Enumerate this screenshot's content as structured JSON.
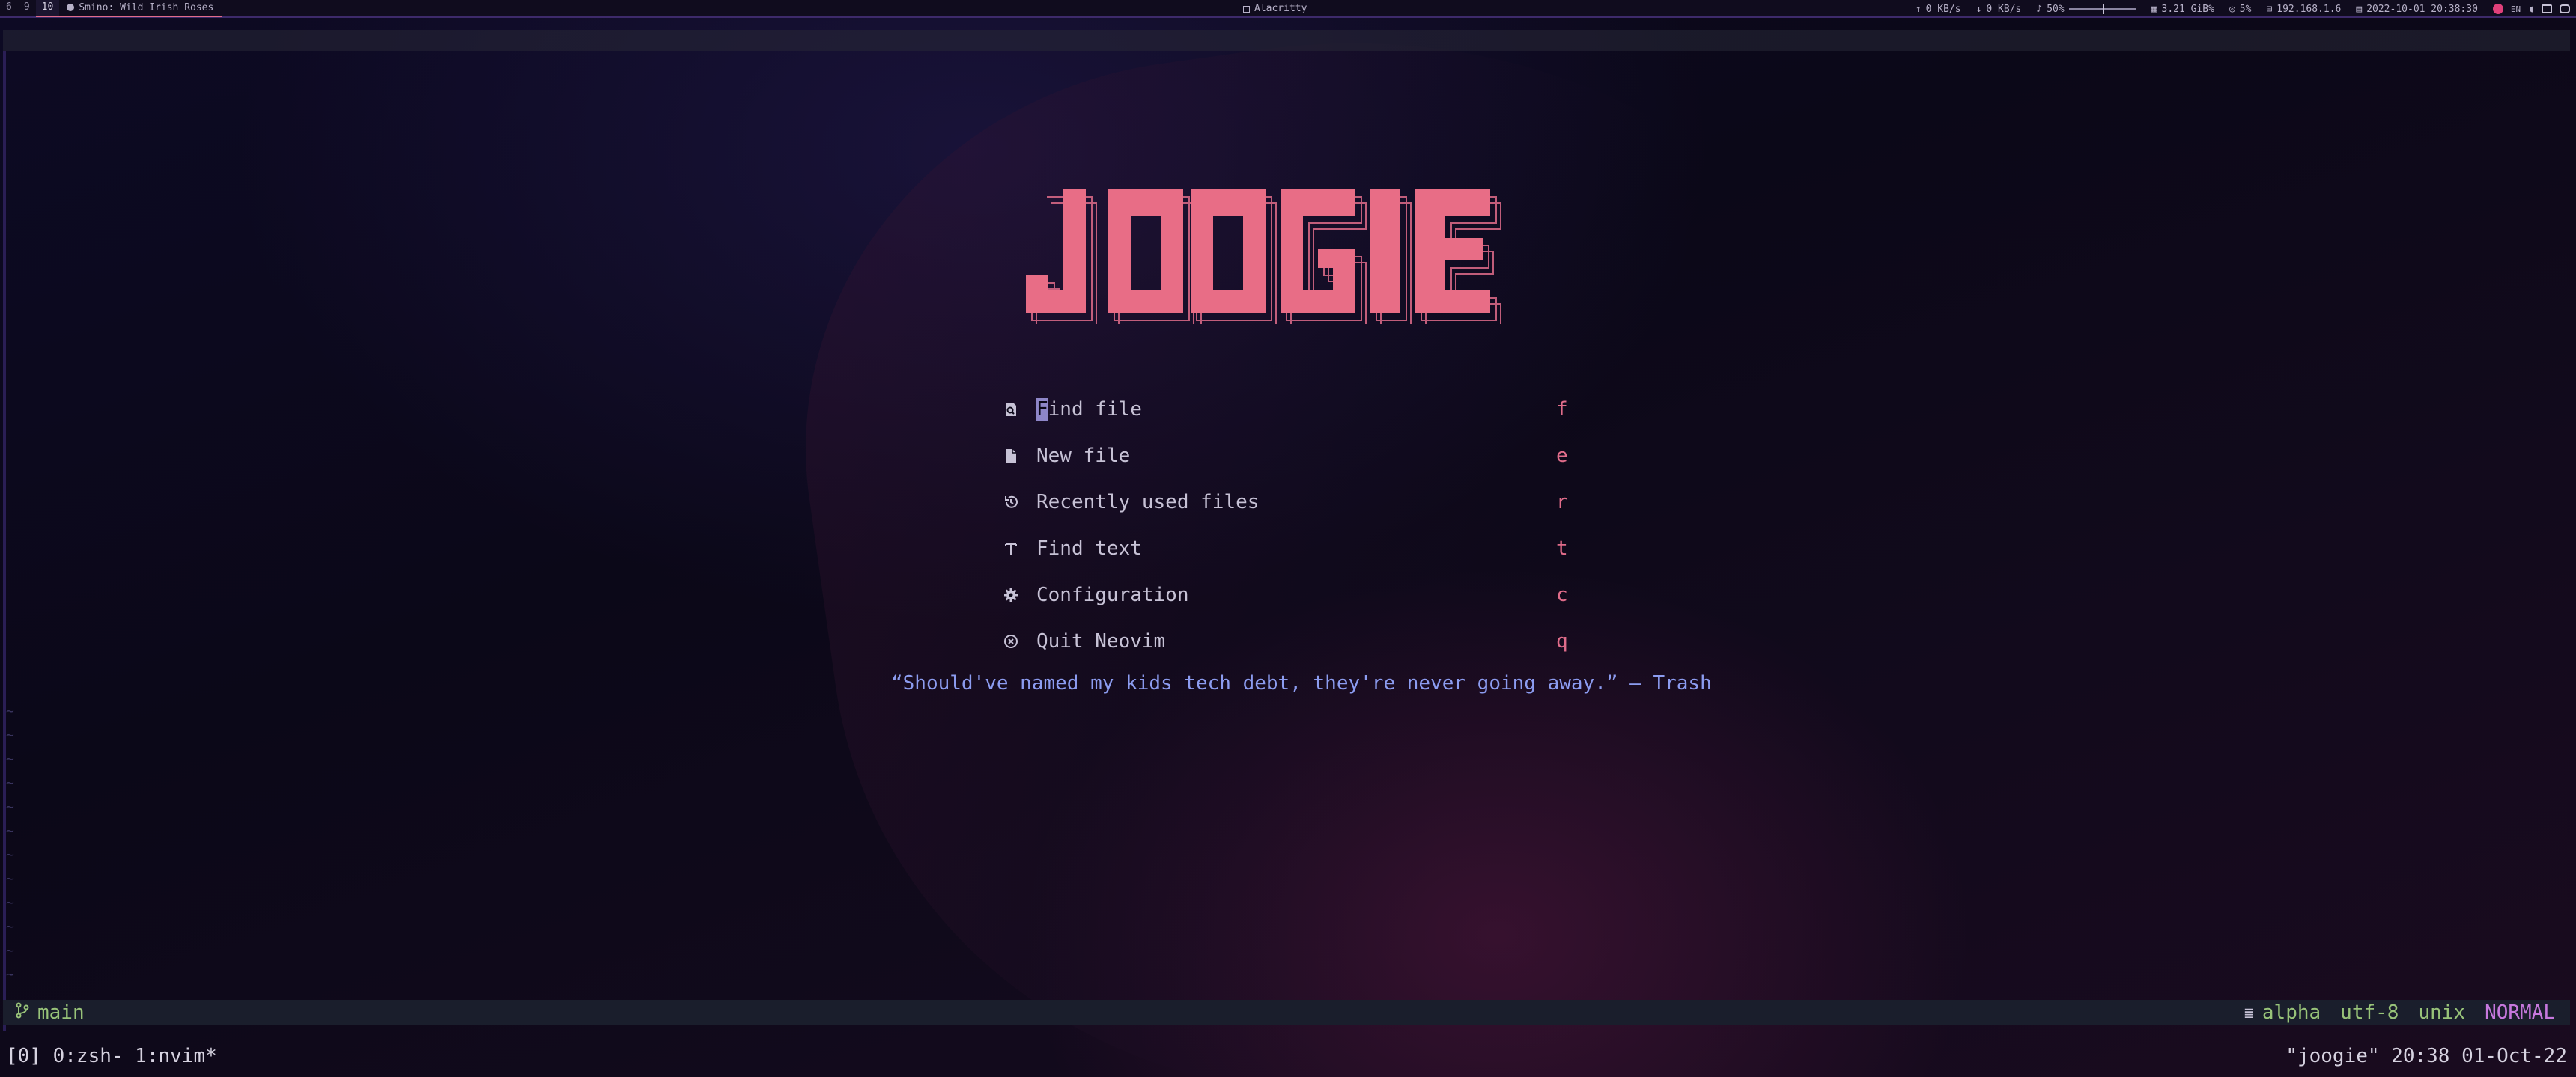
{
  "topbar": {
    "workspaces": [
      "6",
      "9",
      "10"
    ],
    "media": {
      "icon": "spotify-icon",
      "text": "Smino: Wild Irish Roses"
    },
    "window_title": "Alacritty",
    "net_up": "0 KB/s",
    "net_down": "0 KB/s",
    "volume": "50%",
    "volume_level": 0.5,
    "memory": "3.21 GiB%",
    "cpu": "5%",
    "ip": "192.168.1.6",
    "datetime": "2022-10-01 20:38:30",
    "tray_label": "EN"
  },
  "dashboard": {
    "logo_text": "JOOGIE",
    "menu": [
      {
        "label": "Find file",
        "key": "f",
        "icon": "file-search-icon"
      },
      {
        "label": "New file",
        "key": "e",
        "icon": "file-icon"
      },
      {
        "label": "Recently used files",
        "key": "r",
        "icon": "history-icon"
      },
      {
        "label": "Find text",
        "key": "t",
        "icon": "text-icon"
      },
      {
        "label": "Configuration",
        "key": "c",
        "icon": "gear-icon"
      },
      {
        "label": "Quit Neovim",
        "key": "q",
        "icon": "close-circle-icon"
      }
    ],
    "quote": "“Should've named my kids tech debt, they're never going away.” – Trash"
  },
  "statusline": {
    "branch": "main",
    "filetype": "alpha",
    "encoding": "utf-8",
    "format": "unix",
    "mode": "NORMAL"
  },
  "tmux": {
    "left": "[0] 0:zsh- 1:nvim*",
    "right": "\"joogie\" 20:38 01-Oct-22"
  },
  "colors": {
    "accent": "#e06c8a",
    "quote": "#8c9cf0",
    "git": "#98c379",
    "mode": "#c678dd"
  }
}
